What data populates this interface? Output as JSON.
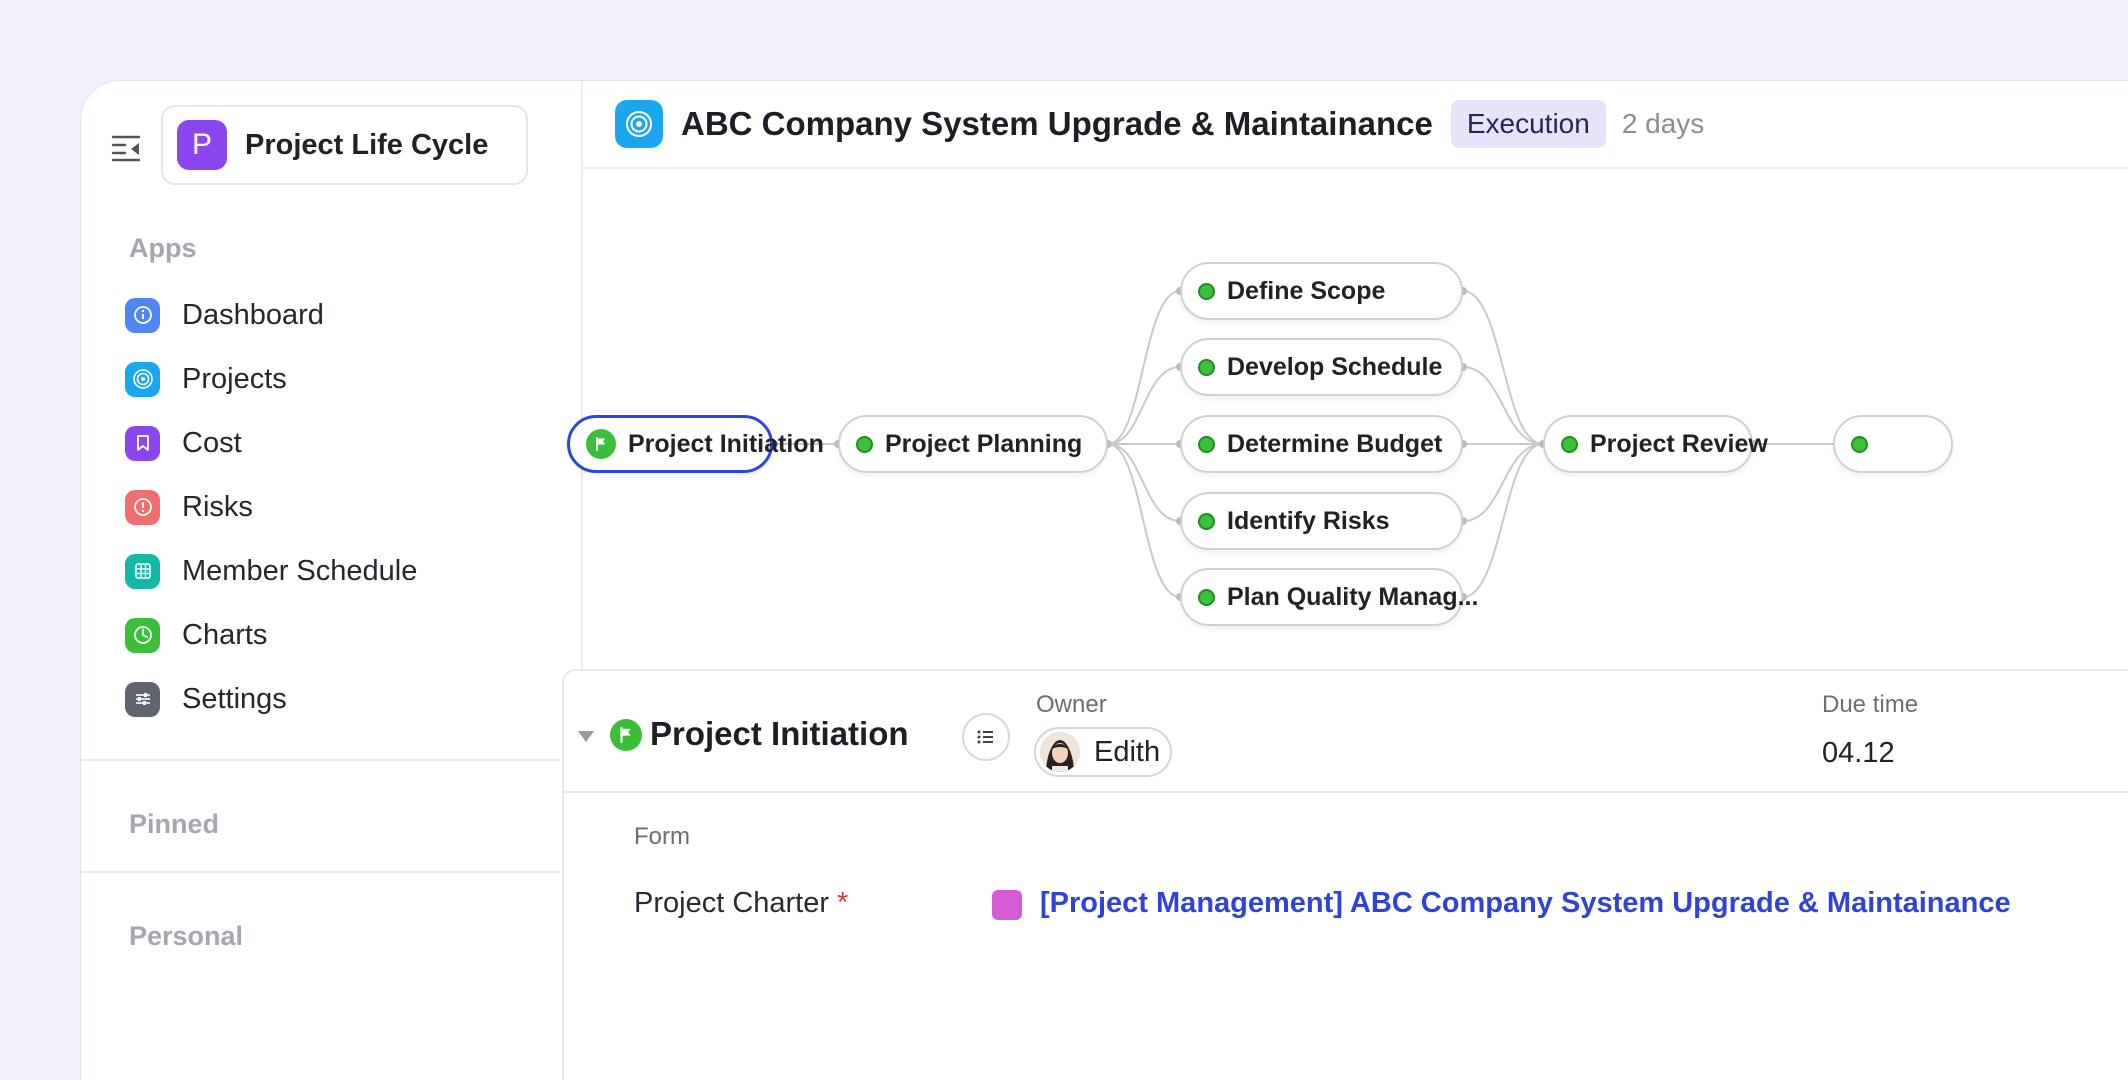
{
  "sidebar": {
    "workspace": {
      "avatar_letter": "P",
      "name": "Project Life Cycle"
    },
    "sections": {
      "apps": "Apps",
      "pinned": "Pinned",
      "personal": "Personal"
    },
    "items": [
      {
        "label": "Dashboard",
        "icon": "info-icon",
        "color": "#4f86f7"
      },
      {
        "label": "Projects",
        "icon": "target-icon",
        "color": "#1aa7ef"
      },
      {
        "label": "Cost",
        "icon": "bookmark-icon",
        "color": "#8b46f0"
      },
      {
        "label": "Risks",
        "icon": "alert-icon",
        "color": "#f26d6d"
      },
      {
        "label": "Member Schedule",
        "icon": "calendar-grid-icon",
        "color": "#14b8a6"
      },
      {
        "label": "Charts",
        "icon": "clock-chart-icon",
        "color": "#3bbf3b"
      },
      {
        "label": "Settings",
        "icon": "sliders-icon",
        "color": "#5f6470"
      }
    ]
  },
  "header": {
    "title": "ABC Company System Upgrade & Maintainance",
    "stage": "Execution",
    "duration": "2 days"
  },
  "flow": {
    "nodes": {
      "initiation": "Project Initiation",
      "planning": "Project Planning",
      "scope": "Define Scope",
      "schedule": "Develop Schedule",
      "budget": "Determine Budget",
      "risks": "Identify Risks",
      "quality": "Plan Quality Manag...",
      "review": "Project Review"
    }
  },
  "panel": {
    "title": "Project Initiation",
    "owner_label": "Owner",
    "owner_name": "Edith",
    "due_label": "Due time",
    "due_value": "04.12",
    "form_label": "Form",
    "field_label": "Project Charter",
    "required_mark": "*",
    "field_value": "[Project Management] ABC Company System Upgrade & Maintainance"
  },
  "colors": {
    "accent": "#2c46e0",
    "status_done": "#3bc23b",
    "link": "#2f43d8"
  }
}
